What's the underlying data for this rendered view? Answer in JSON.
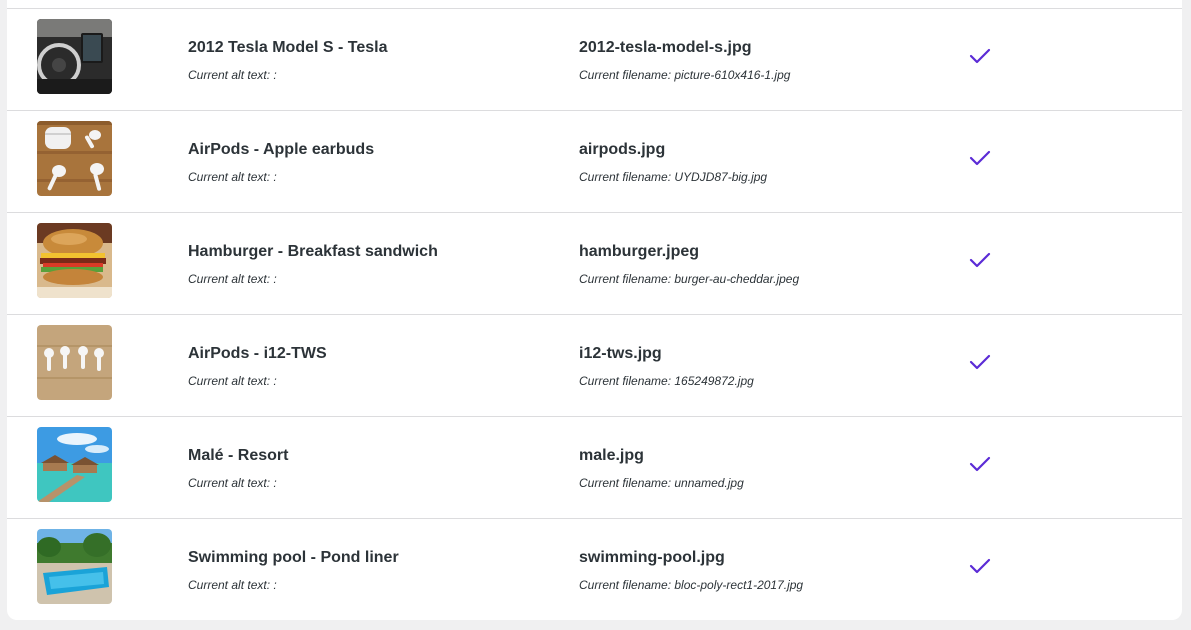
{
  "rows": [
    {
      "title": "2012 Tesla Model S - Tesla",
      "alt_text": "Current alt text: :",
      "new_filename": "2012-tesla-model-s.jpg",
      "current_filename": "Current filename: picture-610x416-1.jpg",
      "thumbnail": "tesla-interior-image",
      "status": "check-icon"
    },
    {
      "title": "AirPods - Apple earbuds",
      "alt_text": "Current alt text: :",
      "new_filename": "airpods.jpg",
      "current_filename": "Current filename: UYDJD87-big.jpg",
      "thumbnail": "airpods-on-wood-image",
      "status": "check-icon"
    },
    {
      "title": "Hamburger - Breakfast sandwich",
      "alt_text": "Current alt text: :",
      "new_filename": "hamburger.jpeg",
      "current_filename": "Current filename: burger-au-cheddar.jpeg",
      "thumbnail": "hamburger-image",
      "status": "check-icon"
    },
    {
      "title": "AirPods - i12-TWS",
      "alt_text": "Current alt text: :",
      "new_filename": "i12-tws.jpg",
      "current_filename": "Current filename: 165249872.jpg",
      "thumbnail": "earbuds-on-wood-image",
      "status": "check-icon"
    },
    {
      "title": "Malé - Resort",
      "alt_text": "Current alt text: :",
      "new_filename": "male.jpg",
      "current_filename": "Current filename: unnamed.jpg",
      "thumbnail": "resort-image",
      "status": "check-icon"
    },
    {
      "title": "Swimming pool - Pond liner",
      "alt_text": "Current alt text: :",
      "new_filename": "swimming-pool.jpg",
      "current_filename": "Current filename: bloc-poly-rect1-2017.jpg",
      "thumbnail": "swimming-pool-image",
      "status": "check-icon"
    }
  ],
  "colors": {
    "check": "#5b2bd6",
    "divider": "#dcdcde",
    "text": "#2c3338",
    "background": "#f0f0f1"
  }
}
